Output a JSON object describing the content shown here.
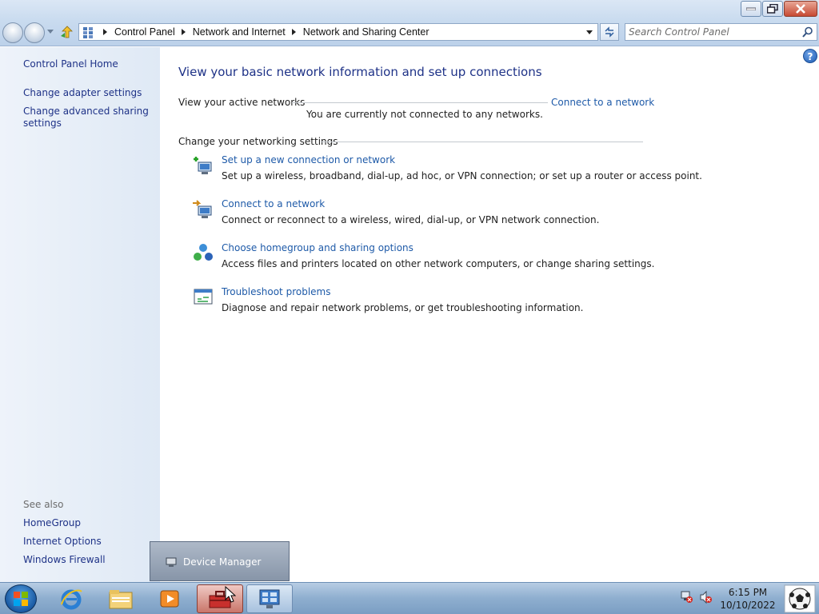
{
  "window": {
    "minimize_label": "minimize",
    "maximize_label": "restore",
    "close_label": "close"
  },
  "navbar": {
    "breadcrumbs": [
      "Control Panel",
      "Network and Internet",
      "Network and Sharing Center"
    ],
    "search_placeholder": "Search Control Panel"
  },
  "sidebar": {
    "home": "Control Panel Home",
    "items": [
      "Change adapter settings",
      "Change advanced sharing settings"
    ],
    "see_also_label": "See also",
    "see_also": [
      "HomeGroup",
      "Internet Options",
      "Windows Firewall"
    ]
  },
  "main": {
    "title": "View your basic network information and set up connections",
    "active_networks_label": "View your active networks",
    "connect_link": "Connect to a network",
    "not_connected": "You are currently not connected to any networks.",
    "change_settings_label": "Change your networking settings",
    "tasks": [
      {
        "title": "Set up a new connection or network",
        "desc": "Set up a wireless, broadband, dial-up, ad hoc, or VPN connection; or set up a router or access point.",
        "icon": "new-connection-icon"
      },
      {
        "title": "Connect to a network",
        "desc": "Connect or reconnect to a wireless, wired, dial-up, or VPN network connection.",
        "icon": "connect-network-icon"
      },
      {
        "title": "Choose homegroup and sharing options",
        "desc": "Access files and printers located on other network computers, or change sharing settings.",
        "icon": "homegroup-icon"
      },
      {
        "title": "Troubleshoot problems",
        "desc": "Diagnose and repair network problems, or get troubleshooting information.",
        "icon": "troubleshoot-icon"
      }
    ]
  },
  "preview": {
    "label": "Device Manager"
  },
  "taskbar": {
    "time": "6:15 PM",
    "date": "10/10/2022"
  },
  "colors": {
    "link": "#1e5aa8",
    "title": "#1e3287",
    "sidebar_bg": "#e5edf7"
  }
}
